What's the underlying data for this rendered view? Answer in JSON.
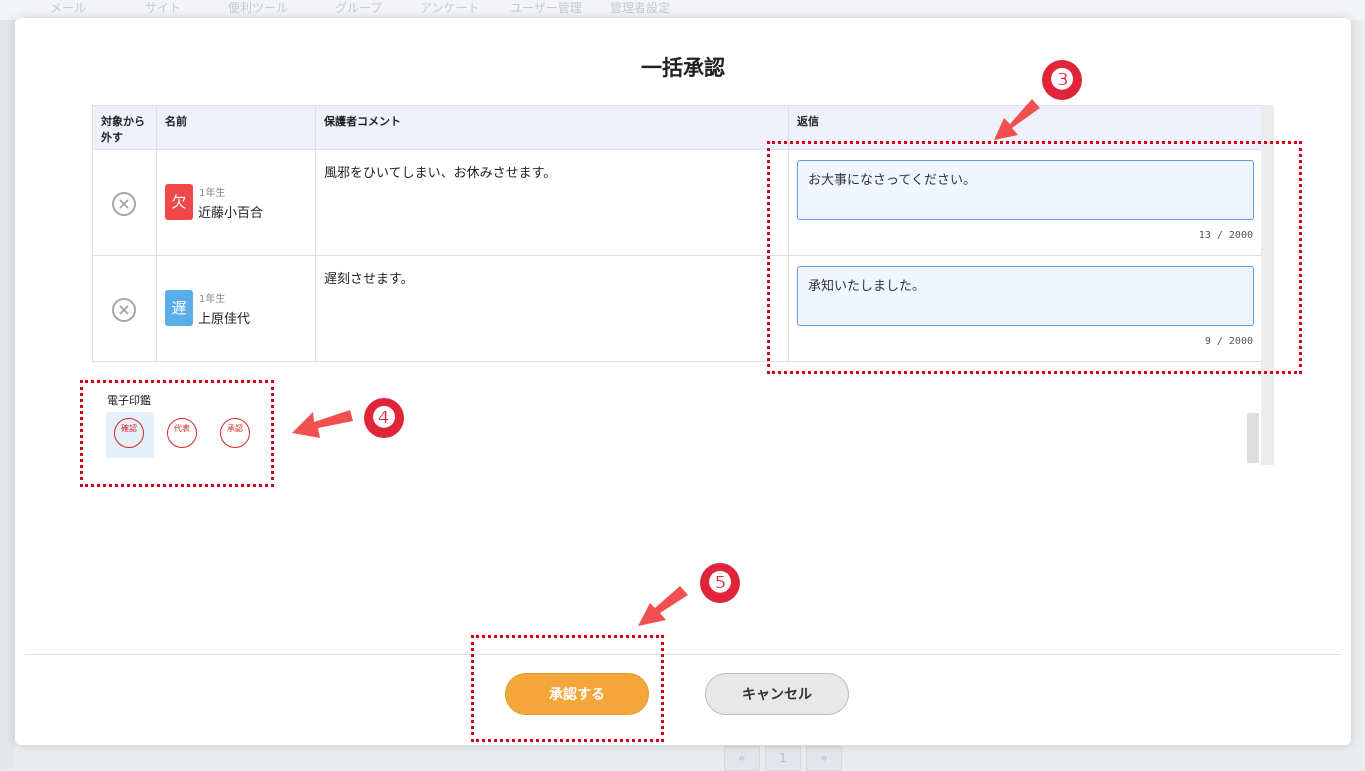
{
  "background_nav": {
    "items": [
      "メール",
      "サイト",
      "便利ツール",
      "グループ",
      "アンケート",
      "ユーザー管理",
      "管理者設定"
    ]
  },
  "modal": {
    "title": "一括承認",
    "table": {
      "headers": {
        "remove": "対象から外す",
        "name": "名前",
        "comment": "保護者コメント",
        "reply": "返信"
      },
      "rows": [
        {
          "badge": "欠",
          "badge_color": "#ee4848",
          "grade": "1年生",
          "name": "近藤小百合",
          "comment": "風邪をひいてしまい、お休みさせます。",
          "reply": "お大事になさってください。",
          "count": "13",
          "max": "2000"
        },
        {
          "badge": "遅",
          "badge_color": "#5aaee8",
          "grade": "1年生",
          "name": "上原佳代",
          "comment": "遅刻させます。",
          "reply": "承知いたしました。",
          "count": "9",
          "max": "2000"
        }
      ]
    },
    "stamps": {
      "label": "電子印鑑",
      "items": [
        {
          "text": "確認",
          "selected": true
        },
        {
          "text": "代表",
          "selected": false
        },
        {
          "text": "承認",
          "selected": false
        }
      ]
    },
    "buttons": {
      "approve": "承認する",
      "cancel": "キャンセル"
    }
  },
  "annotations": {
    "step3": "❸",
    "step4": "❹",
    "step5": "❺",
    "color": "#e0243a"
  },
  "pager": {
    "prev": "«",
    "current": "1",
    "next": "»"
  }
}
